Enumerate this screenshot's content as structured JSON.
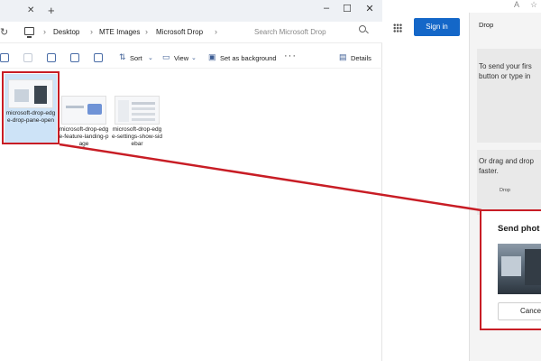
{
  "explorer": {
    "breadcrumb": [
      "Desktop",
      "MTE Images",
      "Microsoft Drop"
    ],
    "search_placeholder": "Search Microsoft Drop",
    "toolbar": {
      "sort_label": "Sort",
      "view_label": "View",
      "set_background_label": "Set as background",
      "details_label": "Details"
    },
    "files": [
      {
        "name": "microsoft-drop-edge-drop-pane-open",
        "selected": true
      },
      {
        "name": "microsoft-drop-edge-feature-landing-page",
        "selected": false
      },
      {
        "name": "microsoft-drop-edge-settings-show-sidebar",
        "selected": false
      }
    ]
  },
  "browser": {
    "signin_label": "Sign in",
    "drop_panel": {
      "header": "Drop",
      "intro_line1": "To send your firs",
      "intro_line2": "button or type in",
      "drag_line1": "Or drag and drop",
      "drag_line2": "faster.",
      "mini_label": "Drop"
    },
    "send_dialog": {
      "title": "Send phot",
      "cancel_label": "Cancel"
    }
  },
  "annotation": {
    "color": "#c81d25"
  }
}
